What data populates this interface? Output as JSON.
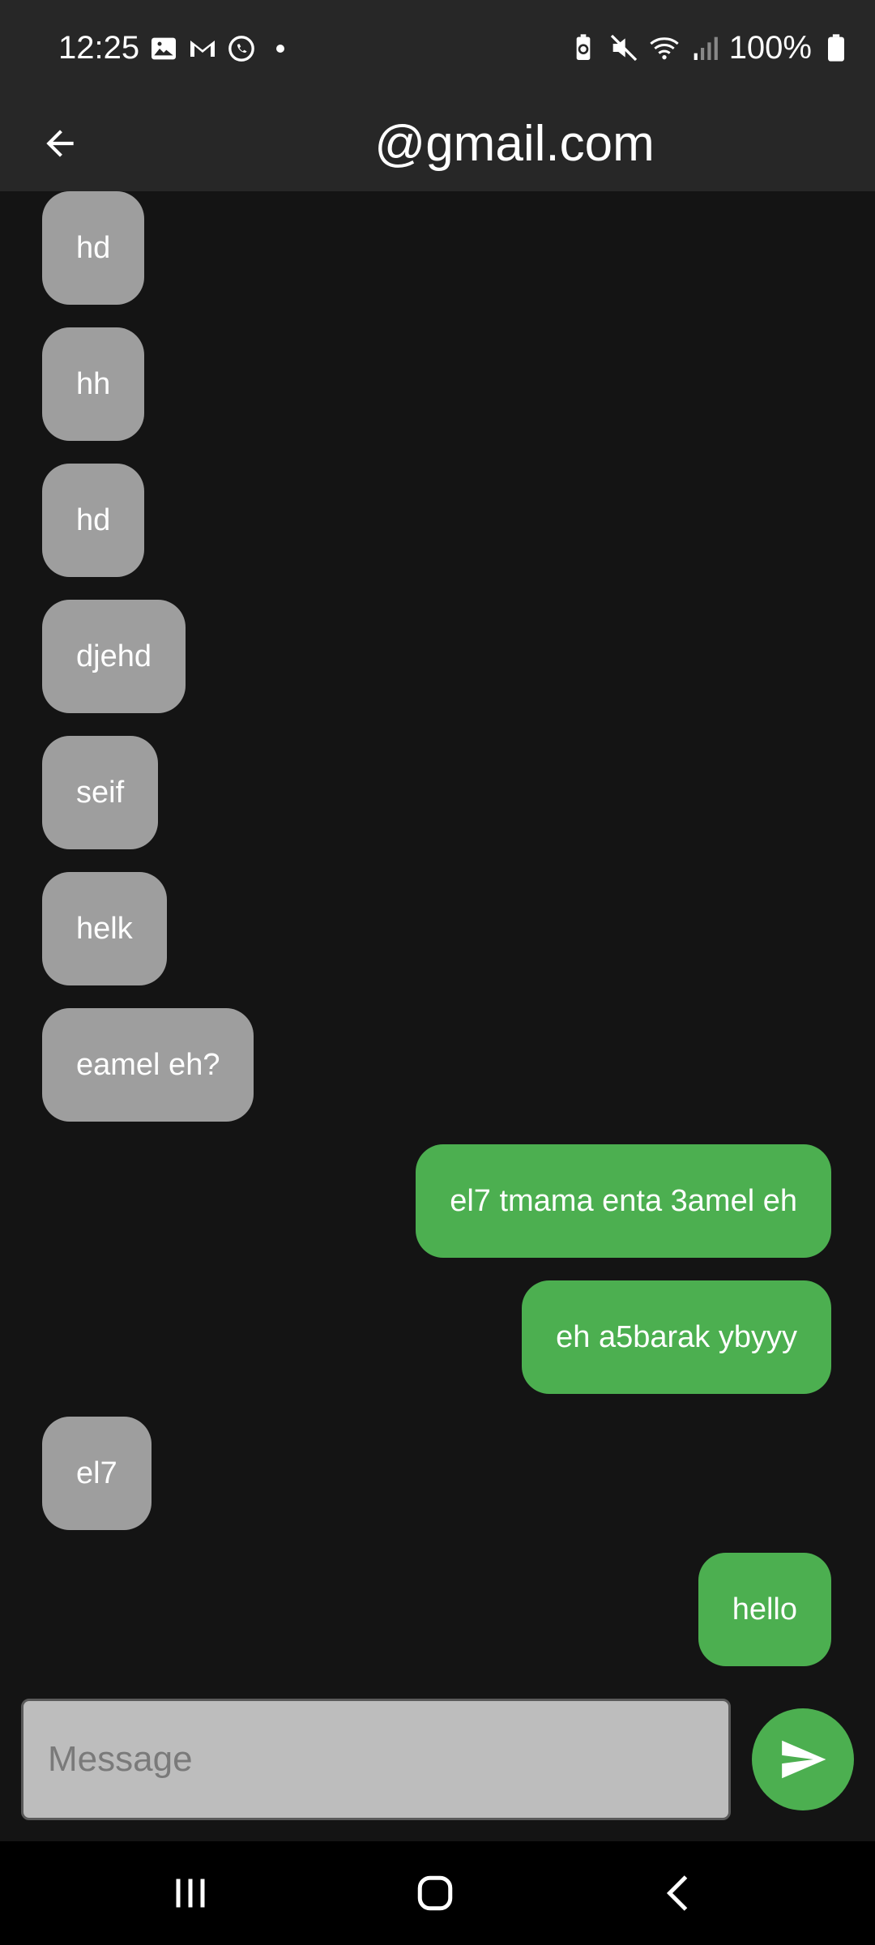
{
  "status_bar": {
    "time": "12:25",
    "battery_percent": "100%",
    "left_icons": [
      "gallery-icon",
      "gmail-icon",
      "whatsapp-icon",
      "notification-dot-icon"
    ],
    "right_icons": [
      "battery-saver-icon",
      "mute-icon",
      "wifi-icon",
      "signal-icon",
      "battery-icon"
    ]
  },
  "app_bar": {
    "title": "@gmail.com",
    "back_icon": "arrow-back-icon"
  },
  "colors": {
    "background": "#141414",
    "app_bar": "#272727",
    "received_bubble": "#9e9e9e",
    "sent_bubble": "#4caf50",
    "input_bg": "#bdbdbd"
  },
  "messages": [
    {
      "text": "hd",
      "direction": "received"
    },
    {
      "text": "hh",
      "direction": "received"
    },
    {
      "text": "hd",
      "direction": "received"
    },
    {
      "text": "djehd",
      "direction": "received"
    },
    {
      "text": "seif",
      "direction": "received"
    },
    {
      "text": "helk",
      "direction": "received"
    },
    {
      "text": "eamel eh?",
      "direction": "received"
    },
    {
      "text": "el7 tmama enta 3amel eh",
      "direction": "sent"
    },
    {
      "text": "eh a5barak ybyyy",
      "direction": "sent"
    },
    {
      "text": "el7",
      "direction": "received"
    },
    {
      "text": "hello",
      "direction": "sent"
    }
  ],
  "composer": {
    "placeholder": "Message",
    "value": "",
    "send_icon": "send-icon"
  },
  "nav_bar": {
    "buttons": [
      "recents-icon",
      "home-icon",
      "back-nav-icon"
    ]
  }
}
